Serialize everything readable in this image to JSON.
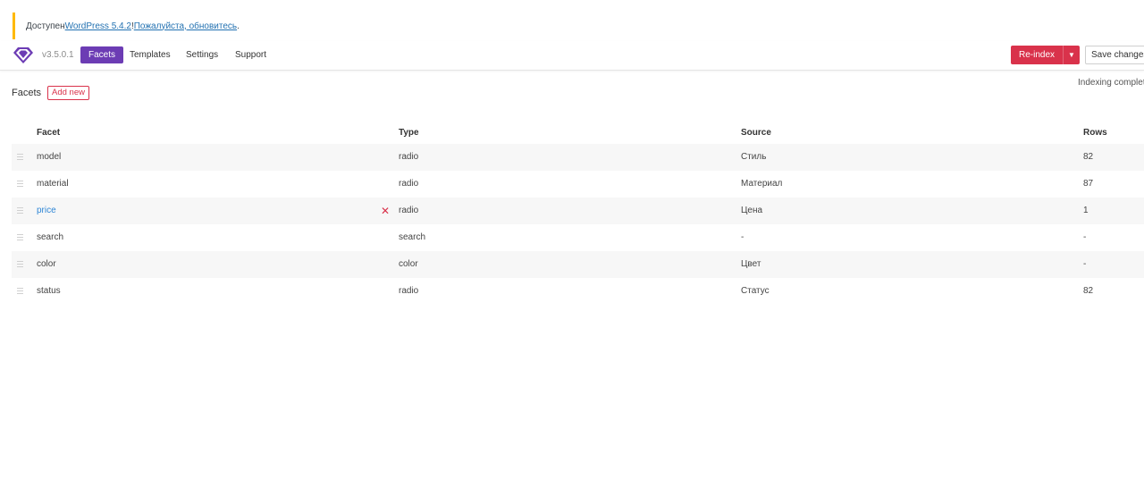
{
  "notice": {
    "prefix": "Доступен ",
    "link1": "WordPress 5.4.2",
    "middle": "! ",
    "link2": "Пожалуйста, обновитесь",
    "suffix": "."
  },
  "header": {
    "version": "v3.5.0.1",
    "tabs": [
      "Facets",
      "Templates",
      "Settings",
      "Support"
    ],
    "active_tab": "Facets",
    "reindex_label": "Re-index",
    "save_label": "Save changes",
    "brand_color": "#6c3cb4",
    "accent_color": "#d9324b"
  },
  "status": {
    "indexing": "Indexing complet"
  },
  "facets_section": {
    "title": "Facets",
    "add_new_label": "Add new",
    "columns": [
      "Facet",
      "Type",
      "Source",
      "Rows"
    ],
    "rows": [
      {
        "facet": "model",
        "type": "radio",
        "source": "Стиль",
        "rows": "82"
      },
      {
        "facet": "material",
        "type": "radio",
        "source": "Материал",
        "rows": "87"
      },
      {
        "facet": "price",
        "type": "radio",
        "source": "Цена",
        "rows": "1"
      },
      {
        "facet": "search",
        "type": "search",
        "source": "-",
        "rows": "-"
      },
      {
        "facet": "color",
        "type": "color",
        "source": "Цвет",
        "rows": "-"
      },
      {
        "facet": "status",
        "type": "radio",
        "source": "Статус",
        "rows": "82"
      }
    ]
  }
}
